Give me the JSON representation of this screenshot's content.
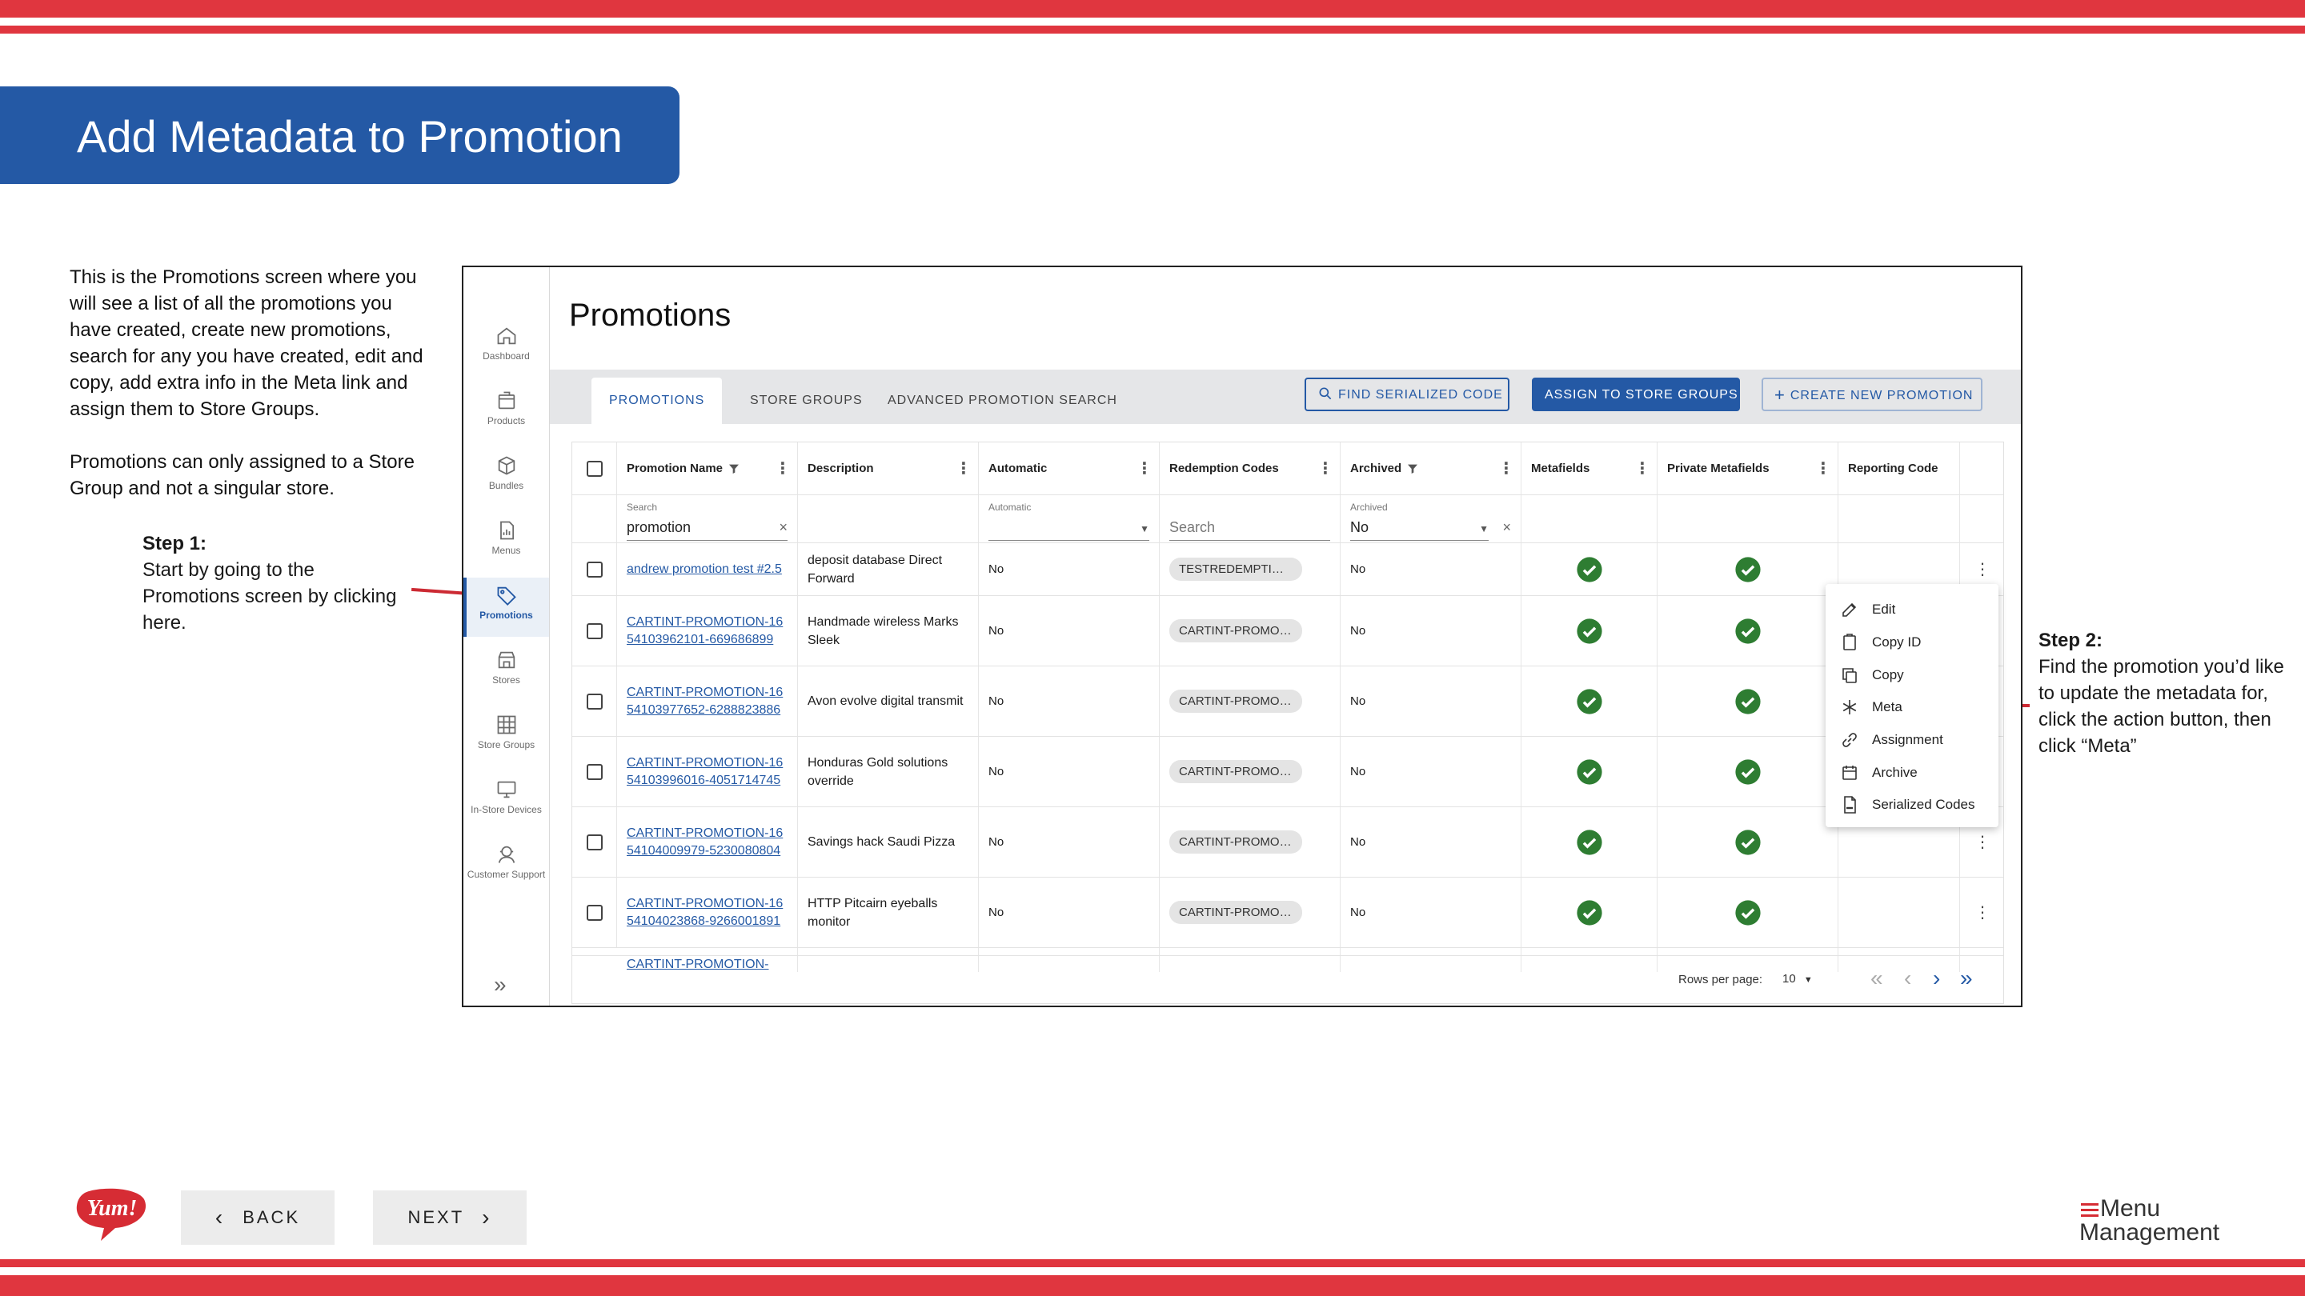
{
  "slide": {
    "title": "Add Metadata to Promotion",
    "intro_p1": "This is the Promotions screen where you will see a list of all the promotions you have created, create new promotions, search for any you have created, edit and copy, add extra info in the Meta link and assign them to Store Groups.",
    "intro_p2": "Promotions can only assigned to a Store Group and not a singular store.",
    "step1_title": "Step 1:",
    "step1_text": "Start by going to the Promotions screen by clicking here.",
    "step2_title": "Step 2:",
    "step2_text": "Find the promotion you’d like to update the metadata for, click the action button, then click “Meta”",
    "back_label": "BACK",
    "next_label": "NEXT",
    "logo_text": "Yum!",
    "brand_line1": "Menu",
    "brand_line2": "Management",
    "accent_color": "#e0363f",
    "title_color": "#2459a5"
  },
  "app": {
    "sidebar": [
      {
        "label": "Dashboard",
        "icon": "home-icon"
      },
      {
        "label": "Products",
        "icon": "products-icon"
      },
      {
        "label": "Bundles",
        "icon": "bundles-icon"
      },
      {
        "label": "Menus",
        "icon": "menus-icon"
      },
      {
        "label": "Promotions",
        "icon": "tag-icon",
        "active": true
      },
      {
        "label": "Stores",
        "icon": "store-icon"
      },
      {
        "label": "Store Groups",
        "icon": "grid-icon"
      },
      {
        "label": "In-Store Devices",
        "icon": "device-icon"
      },
      {
        "label": "Customer Support",
        "icon": "support-icon"
      }
    ],
    "page_title": "Promotions",
    "tabs": [
      "PROMOTIONS",
      "STORE GROUPS",
      "ADVANCED PROMOTION SEARCH"
    ],
    "buttons": {
      "find": "FIND SERIALIZED CODE",
      "assign": "ASSIGN TO STORE GROUPS",
      "create": "CREATE NEW PROMOTION"
    },
    "columns": [
      "Promotion Name",
      "Description",
      "Automatic",
      "Redemption Codes",
      "Archived",
      "Metafields",
      "Private Metafields",
      "Reporting Code"
    ],
    "filters": {
      "search_label": "Search",
      "search_value": "promotion",
      "automatic_label": "Automatic",
      "redemption_placeholder": "Search",
      "archived_label": "Archived",
      "archived_value": "No"
    },
    "rows": [
      {
        "name": "andrew promotion test #2.5",
        "desc": "deposit database Direct Forward",
        "automatic": "No",
        "code": "TESTREDEMPTIONC...",
        "archived": "No"
      },
      {
        "name": "CARTINT-PROMOTION-1654103962101-669686899",
        "desc": "Handmade wireless Marks Sleek",
        "automatic": "No",
        "code": "CARTINT-PROMOTI...",
        "archived": "No"
      },
      {
        "name": "CARTINT-PROMOTION-1654103977652-6288823886",
        "desc": "Avon evolve digital transmit",
        "automatic": "No",
        "code": "CARTINT-PROMOTI...",
        "archived": "No"
      },
      {
        "name": "CARTINT-PROMOTION-1654103996016-4051714745",
        "desc": "Honduras Gold solutions override",
        "automatic": "No",
        "code": "CARTINT-PROMOTI...",
        "archived": "No"
      },
      {
        "name": "CARTINT-PROMOTION-1654104009979-5230080804",
        "desc": "Savings hack Saudi Pizza",
        "automatic": "No",
        "code": "CARTINT-PROMOTI...",
        "archived": "No"
      },
      {
        "name": "CARTINT-PROMOTION-1654104023868-9266001891",
        "desc": "HTTP Pitcairn eyeballs monitor",
        "automatic": "No",
        "code": "CARTINT-PROMOTI...",
        "archived": "No"
      }
    ],
    "partial_row": "CARTINT-PROMOTION-",
    "pager": {
      "rows_label": "Rows per page:",
      "rows_value": "10"
    },
    "action_menu": [
      "Edit",
      "Copy ID",
      "Copy",
      "Meta",
      "Assignment",
      "Archive",
      "Serialized Codes"
    ],
    "check_color": "#2e7d32",
    "primary_color": "#2459a5"
  }
}
